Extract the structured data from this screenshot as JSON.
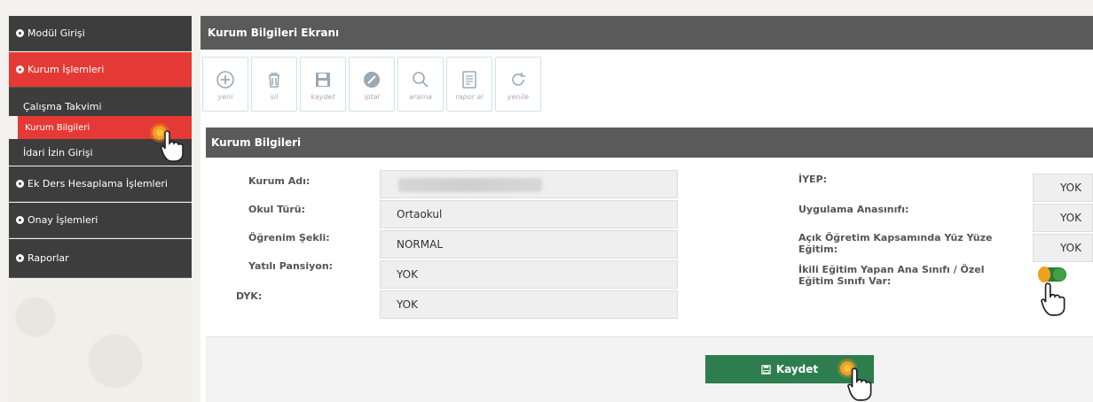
{
  "sidebar": {
    "items": [
      {
        "label": "Modül Girişi"
      },
      {
        "label": "Kurum İşlemleri"
      },
      {
        "label": "Ek Ders Hesaplama İşlemleri"
      },
      {
        "label": "Onay İşlemleri"
      },
      {
        "label": "Raporlar"
      }
    ],
    "sub_items": [
      {
        "label": "Çalışma Takvimi"
      },
      {
        "label": "Kurum Bilgileri"
      },
      {
        "label": "İdari İzin Girişi"
      }
    ]
  },
  "header": {
    "title": "Kurum Bilgileri Ekranı"
  },
  "toolbar": {
    "buttons": [
      {
        "label": "yeni",
        "icon": "plus-circle-icon"
      },
      {
        "label": "sil",
        "icon": "trash-icon"
      },
      {
        "label": "kaydet",
        "icon": "floppy-icon"
      },
      {
        "label": "iptal",
        "icon": "cancel-icon"
      },
      {
        "label": "arama",
        "icon": "search-icon"
      },
      {
        "label": "rapor al",
        "icon": "report-icon"
      },
      {
        "label": "yenile",
        "icon": "refresh-icon"
      }
    ]
  },
  "section": {
    "title": "Kurum Bilgileri"
  },
  "form": {
    "left": [
      {
        "label": "Kurum Adı:",
        "value": ""
      },
      {
        "label": "Okul Türü:",
        "value": "Ortaokul"
      },
      {
        "label": "Öğrenim Şekli:",
        "value": "NORMAL"
      },
      {
        "label": "Yatılı Pansiyon:",
        "value": "YOK"
      },
      {
        "label": "DYK:",
        "value": "YOK"
      }
    ],
    "right": [
      {
        "label": "İYEP:",
        "value": "YOK"
      },
      {
        "label": "Uygulama Anasınıfı:",
        "value": "YOK"
      },
      {
        "label": "Açık Öğretim Kapsamında Yüz Yüze Eğitim:",
        "value": "YOK"
      },
      {
        "label": "İkili Eğitim Yapan Ana Sınıfı / Özel Eğitim Sınıfı Var:",
        "toggle": true
      }
    ]
  },
  "footer": {
    "save_label": "Kaydet"
  },
  "colors": {
    "accent_red": "#e53935",
    "sidebar_dark": "#3d3d3d",
    "header_gray": "#5a5a5a",
    "save_green": "#2e7d4f"
  }
}
